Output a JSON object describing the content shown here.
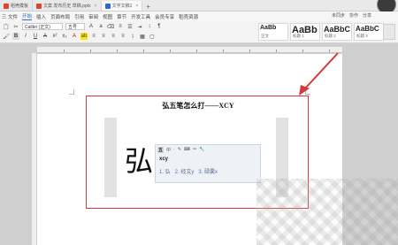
{
  "tabs": [
    {
      "label": "稻壳模板",
      "color": "#d9472b"
    },
    {
      "label": "文案 发布历史 草稿.pptx",
      "color": "#d9472b"
    },
    {
      "label": "文字文稿1",
      "color": "#2a6ac8",
      "active": true
    }
  ],
  "tab_add_label": "+",
  "menu": [
    "三 文件",
    "开始",
    "插入",
    "页面布局",
    "引用",
    "审阅",
    "视图",
    "章节",
    "开发工具",
    "会员专享",
    "稻壳资源"
  ],
  "menu_active_index": 1,
  "menu_right": [
    "未同步",
    "协作",
    "分享"
  ],
  "ribbon": {
    "font_name": "Calibri (正文)",
    "font_size": "五号",
    "styles": [
      {
        "sample": "AaBb",
        "name": "正文"
      },
      {
        "sample": "AaBb",
        "name": "标题 1"
      },
      {
        "sample": "AaBbC",
        "name": "标题 2"
      },
      {
        "sample": "AaBbC",
        "name": "标题 3"
      }
    ]
  },
  "document": {
    "title": "弘五笔怎么打——XCY",
    "big_char": "弘",
    "ime": {
      "logo": "五",
      "tools": [
        "中",
        "·",
        "✎",
        "⌨",
        "✂",
        "🔧"
      ],
      "input": "xcy",
      "candidates": [
        "1. 弘",
        "2. 经文y",
        "3. 碌囊x"
      ]
    }
  },
  "colors": {
    "highlight": "#d33a3a",
    "accent": "#2a6ac8"
  }
}
